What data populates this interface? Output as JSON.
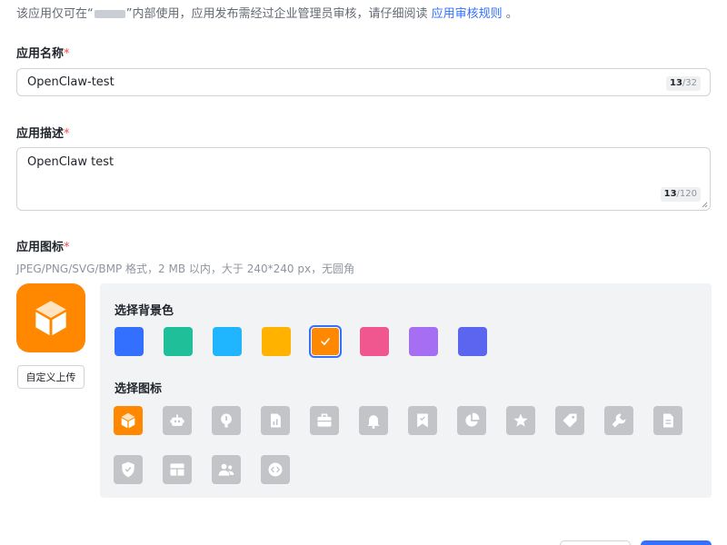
{
  "notice": {
    "prefix": "该应用仅可在“",
    "suffix": "”内部使用，应用发布需经过企业管理员审核，请仔细阅读",
    "link": "应用审核规则",
    "end": "。"
  },
  "name_field": {
    "label": "应用名称",
    "required": "*",
    "value": "OpenClaw-test",
    "count": "13",
    "max": "/32"
  },
  "desc_field": {
    "label": "应用描述",
    "required": "*",
    "value": "OpenClaw test",
    "count": "13",
    "max": "/120"
  },
  "icon_field": {
    "label": "应用图标",
    "required": "*",
    "hint": "JPEG/PNG/SVG/BMP 格式，2 MB 以内，大于 240*240 px，无圆角",
    "upload_label": "自定义上传",
    "preview_icon": "cube-icon",
    "preview_color": "#ff8800"
  },
  "picker": {
    "bg_title": "选择背景色",
    "icon_title": "选择图标",
    "selected_color": "#ff8800",
    "colors": [
      "#3370ff",
      "#1fbf9a",
      "#1fb6ff",
      "#ffb300",
      "#ff8800",
      "#f0578f",
      "#a66ef2",
      "#5b65f0"
    ],
    "icons": [
      "cube-icon",
      "robot-icon",
      "lightbulb-icon",
      "chart-doc-icon",
      "briefcase-icon",
      "bell-icon",
      "bookmark-icon",
      "pie-chart-icon",
      "star-icon",
      "tag-icon",
      "wrench-icon",
      "document-icon",
      "shield-icon",
      "layout-icon",
      "users-icon",
      "code-icon"
    ]
  },
  "colors": {
    "accent": "#3370ff",
    "required": "#f54a45",
    "icon_inactive": "#c2c4c8",
    "panel_bg": "#f2f3f5"
  }
}
